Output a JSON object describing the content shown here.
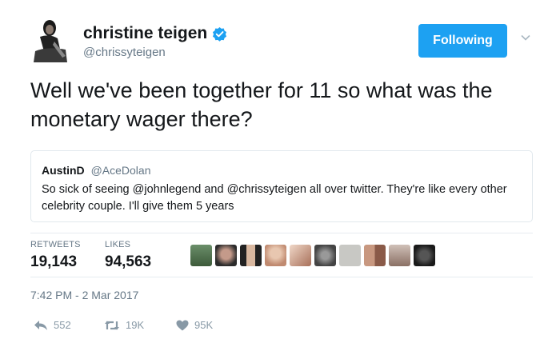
{
  "user": {
    "display_name": "christine teigen",
    "handle": "@chrissyteigen",
    "verified": true,
    "follow_label": "Following"
  },
  "tweet": {
    "text": "Well we've been together for 11 so what was the monetary wager there?"
  },
  "quoted": {
    "name": "AustinD",
    "handle": "@AceDolan",
    "text": "So sick of seeing @johnlegend and @chrissyteigen all over twitter. They're like every other celebrity couple. I'll give them 5 years"
  },
  "stats": {
    "retweets_label": "RETWEETS",
    "retweets": "19,143",
    "likes_label": "LIKES",
    "likes": "94,563"
  },
  "liker_avatar_count": 10,
  "timestamp": "7:42 PM - 2 Mar 2017",
  "actions": {
    "reply": "552",
    "retweet": "19K",
    "like": "95K"
  },
  "colors": {
    "accent": "#1da1f2",
    "text": "#14171a",
    "muted": "#657786",
    "icon": "#8899a6",
    "border": "#e1e8ed"
  }
}
